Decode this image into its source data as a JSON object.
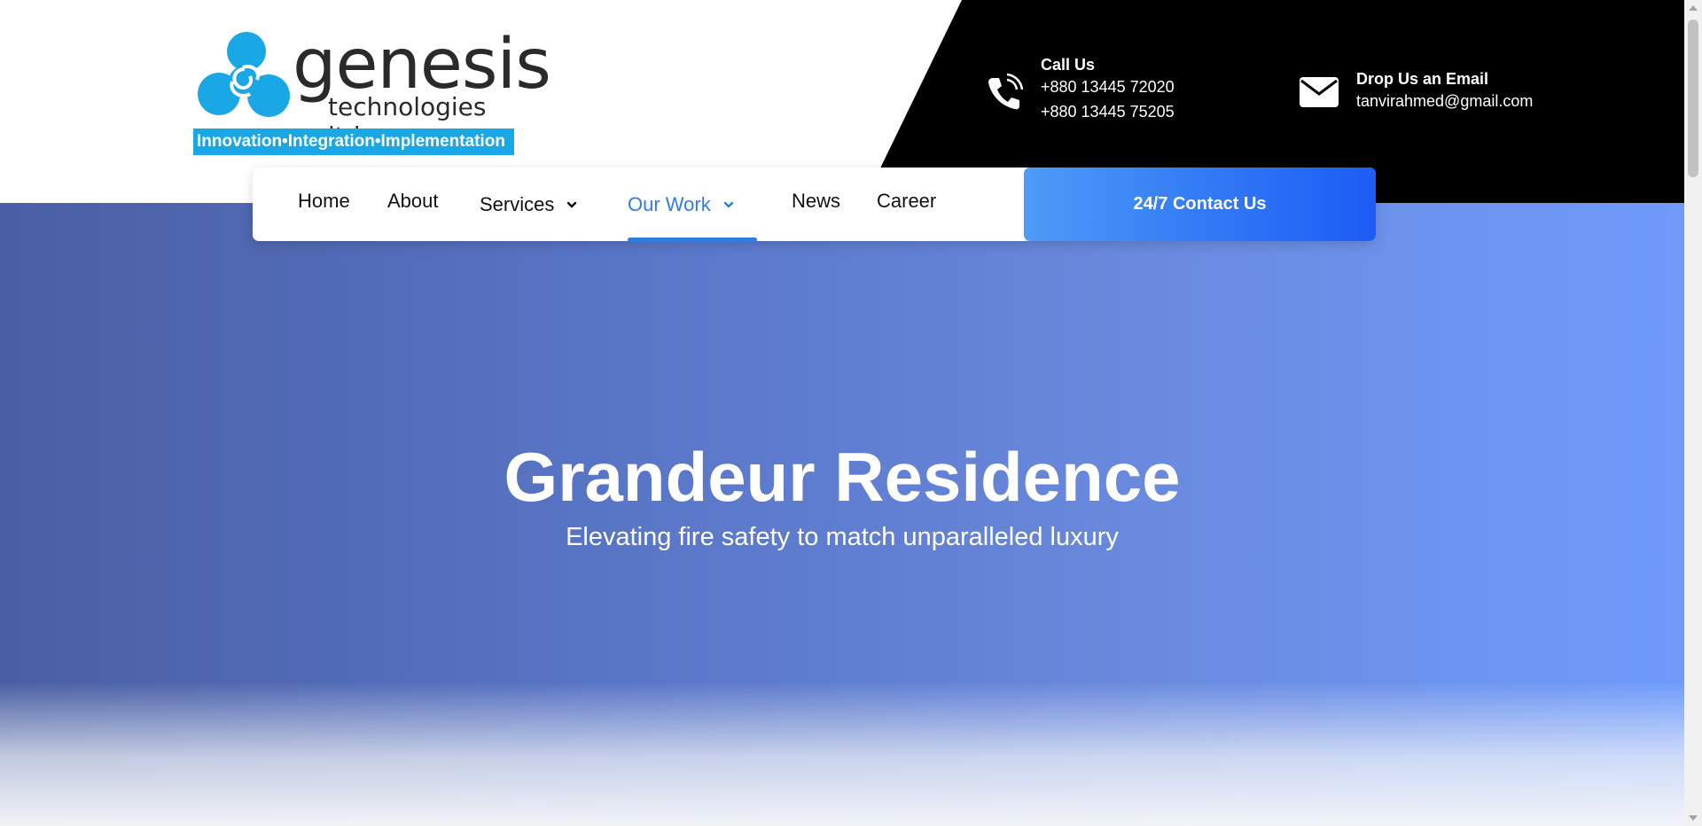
{
  "brand": {
    "name": "genesis",
    "subtitle": "technologies ltd",
    "tagline": "Innovation•Integration•Implementation",
    "logo_color": "#1aa7e5"
  },
  "contact": {
    "call": {
      "label": "Call Us",
      "phone1": "+880 13445 72020",
      "phone2": "+880 13445 75205",
      "icon": "phone-icon"
    },
    "email": {
      "label": "Drop Us an Email",
      "address": "tanvirahmed@gmail.com",
      "icon": "envelope-icon"
    }
  },
  "nav": {
    "items": [
      {
        "label": "Home"
      },
      {
        "label": "About"
      },
      {
        "label": "Services"
      },
      {
        "label": "Our Work"
      },
      {
        "label": "News"
      },
      {
        "label": "Career"
      }
    ],
    "active": "Our Work",
    "cta_label": "24/7 Contact Us",
    "accent": "#2f7de1"
  },
  "hero": {
    "title": "Grandeur Residence",
    "subtitle": "Elevating fire safety to match unparalleled luxury"
  }
}
